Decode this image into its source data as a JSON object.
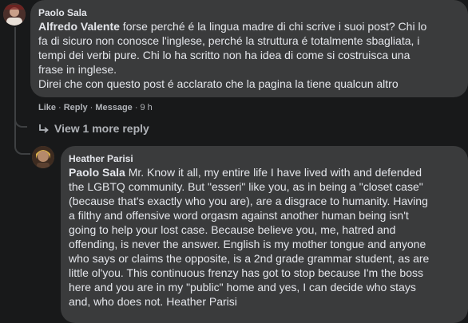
{
  "comment1": {
    "author": "Paolo Sala",
    "mention": "Alfredo Valente",
    "lines": [
      " forse perché é la lingua madre di chi scrive i suoi post? Chi lo",
      "fa di sicuro non conosce l'inglese, perché la struttura é totalmente sbagliata, i",
      "tempi dei verbi pure. Chi lo ha scritto non ha idea di come si costruisca una",
      "frase in inglese.",
      "Direi che con questo post é acclarato che la pagina la tiene qualcun altro"
    ],
    "actions": {
      "like": "Like",
      "reply": "Reply",
      "message": "Message",
      "sep": "·",
      "time": "9 h"
    }
  },
  "view_more": {
    "label": "View 1 more reply",
    "icon": "reply-arrow-icon"
  },
  "comment2": {
    "author": "Heather Parisi",
    "mention": "Paolo Sala",
    "lines": [
      " Mr. Know it all, my entire life I have lived with and defended",
      "the LGBTQ community. But \"esseri\" like you, as in being a \"closet case\"",
      "(because that's exactly who you are), are a disgrace to humanity. Having",
      "a filthy and offensive word orgasm against another human being isn't",
      "going to help your lost case. Because believe you, me, hatred and",
      "offending, is never the answer. English is my mother tongue and anyone",
      "who says or claims the opposite, is a 2nd grade grammar student, as are",
      "little ol'you. This continuous frenzy has got to stop because I'm the boss",
      "here and you are in my \"public\" home and yes, I can decide who stays",
      "and, who does not. Heather Parisi"
    ]
  },
  "colors": {
    "background": "#18191a",
    "bubble": "#3a3b3c",
    "text": "#e4e6eb",
    "muted": "#b0b3b8"
  }
}
